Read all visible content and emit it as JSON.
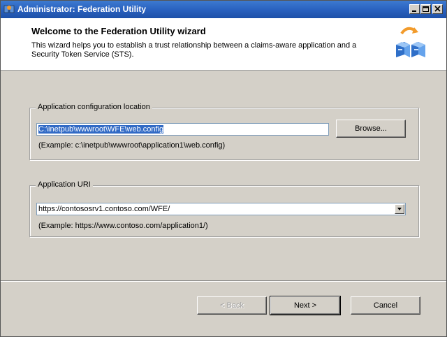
{
  "window": {
    "title": "Administrator: Federation Utility",
    "controls": {
      "minimize": "minimize-icon",
      "maximize": "maximize-icon",
      "close": "close-icon"
    }
  },
  "header": {
    "title": "Welcome to the Federation Utility wizard",
    "description": "This wizard helps you to establish a trust relationship between a claims-aware application and a Security Token Service (STS).",
    "icon": "federation-servers-icon"
  },
  "app_config": {
    "group_label": "Application configuration location",
    "value": "C:\\inetpub\\wwwroot\\WFE\\web.config",
    "browse_label": "Browse...",
    "example": "(Example: c:\\inetpub\\wwwroot\\application1\\web.config)"
  },
  "app_uri": {
    "group_label": "Application URI",
    "value": "https://contososrv1.contoso.com/WFE/",
    "example": "(Example: https://www.contoso.com/application1/)"
  },
  "footer": {
    "back_label": "< Back",
    "next_label": "Next >",
    "cancel_label": "Cancel"
  },
  "colors": {
    "titlebar": "#2a62c0",
    "selection": "#316ac5",
    "dialog_bg": "#d4d0c8"
  }
}
